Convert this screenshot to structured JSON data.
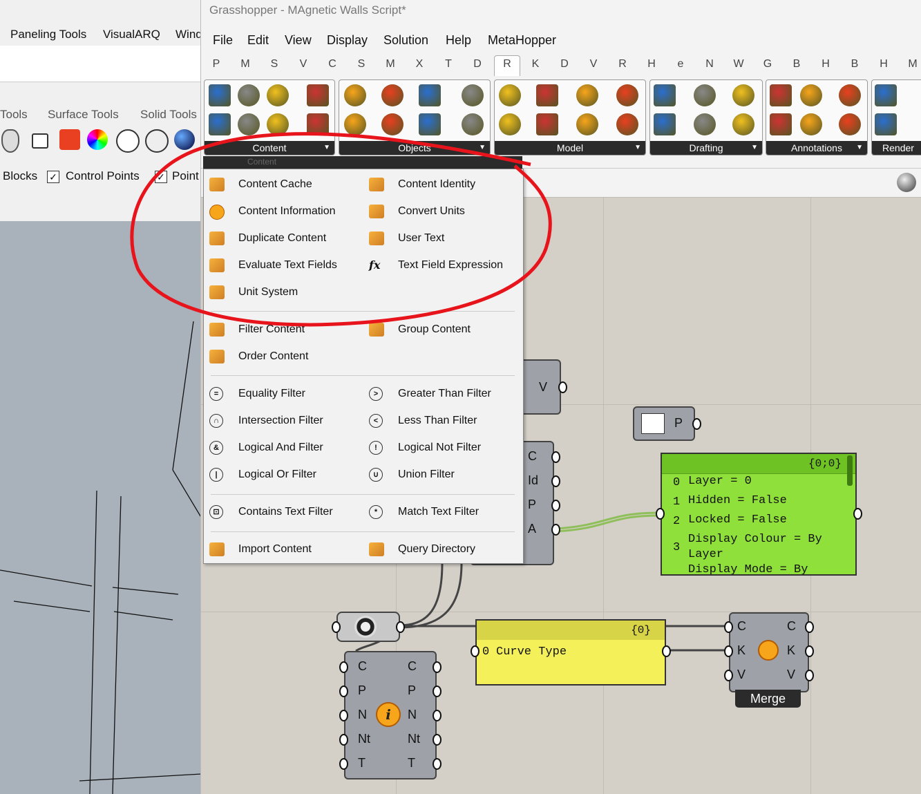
{
  "rhino": {
    "menu": [
      "Paneling Tools",
      "VisualARQ",
      "Wind"
    ],
    "tabs": [
      "Tools",
      "Surface Tools",
      "Solid Tools"
    ],
    "blocks_label": "Blocks",
    "control_points_label": "Control Points",
    "point_label": "Point"
  },
  "gh": {
    "title": "Grasshopper - MAgnetic Walls Script*",
    "menu": [
      "File",
      "Edit",
      "View",
      "Display",
      "Solution",
      "Help",
      "MetaHopper"
    ],
    "tabs": [
      "P",
      "M",
      "S",
      "V",
      "C",
      "S",
      "M",
      "X",
      "T",
      "D",
      "R",
      "K",
      "D",
      "V",
      "R",
      "H",
      "e",
      "N",
      "W",
      "G",
      "B",
      "H",
      "B",
      "H",
      "M"
    ],
    "active_tab": "R",
    "panels": [
      "Content",
      "Objects",
      "Model",
      "Drafting",
      "Annotations",
      "Render"
    ],
    "dropdown_header": "Content",
    "menu_items": [
      {
        "label": "Content Cache",
        "icon": "content-cache-icon"
      },
      {
        "label": "Content Identity",
        "icon": "content-identity-icon"
      },
      {
        "label": "Content Information",
        "icon": "info-icon"
      },
      {
        "label": "Convert Units",
        "icon": "convert-units-icon"
      },
      {
        "label": "Duplicate Content",
        "icon": "duplicate-icon"
      },
      {
        "label": "User Text",
        "icon": "user-text-icon"
      },
      {
        "label": "Evaluate Text Fields",
        "icon": "evaluate-text-icon"
      },
      {
        "label": "Text Field Expression",
        "icon": "fx-icon"
      },
      {
        "label": "Unit System",
        "icon": "unit-system-icon"
      },
      {
        "label": "Filter Content",
        "icon": "filter-icon"
      },
      {
        "label": "Group Content",
        "icon": "group-icon"
      },
      {
        "label": "Order Content",
        "icon": "order-icon"
      },
      {
        "label": "Equality Filter",
        "icon": "equality-icon"
      },
      {
        "label": "Greater Than Filter",
        "icon": "greater-icon"
      },
      {
        "label": "Intersection Filter",
        "icon": "intersection-icon"
      },
      {
        "label": "Less Than Filter",
        "icon": "less-icon"
      },
      {
        "label": "Logical And Filter",
        "icon": "and-icon"
      },
      {
        "label": "Logical Not Filter",
        "icon": "not-icon"
      },
      {
        "label": "Logical Or Filter",
        "icon": "or-icon"
      },
      {
        "label": "Union Filter",
        "icon": "union-icon"
      },
      {
        "label": "Contains Text Filter",
        "icon": "contains-icon"
      },
      {
        "label": "Match Text Filter",
        "icon": "match-icon"
      },
      {
        "label": "Import Content",
        "icon": "import-icon"
      },
      {
        "label": "Query Directory",
        "icon": "query-icon"
      }
    ]
  },
  "canvas": {
    "node_v_output": "V",
    "node_p_output": "P",
    "node_cidpa_ports": [
      "C",
      "Id",
      "P",
      "A"
    ],
    "panel_layer": {
      "header": "{0;0}",
      "rows": [
        {
          "idx": "0",
          "text": "Layer = 0"
        },
        {
          "idx": "1",
          "text": "Hidden = False"
        },
        {
          "idx": "2",
          "text": "Locked = False"
        },
        {
          "idx": "3",
          "text": "Display Colour = By Layer"
        },
        {
          "idx": "",
          "text": "Display Mode = By"
        }
      ]
    },
    "panel_curve": {
      "header": "{0}",
      "idx": "0",
      "text": "Curve Type"
    },
    "info_node": {
      "inputs": [
        "C",
        "P",
        "N",
        "Nt",
        "T"
      ],
      "outputs": [
        "C",
        "P",
        "N",
        "Nt",
        "T"
      ]
    },
    "merge_node": {
      "inputs": [
        "C",
        "K",
        "V"
      ],
      "outputs": [
        "C",
        "K",
        "V"
      ],
      "label": "Merge"
    }
  },
  "colors": {
    "highlight_circle": "#e8141c",
    "panel_green": "#8fe03a",
    "panel_yellow": "#f4f05a"
  }
}
